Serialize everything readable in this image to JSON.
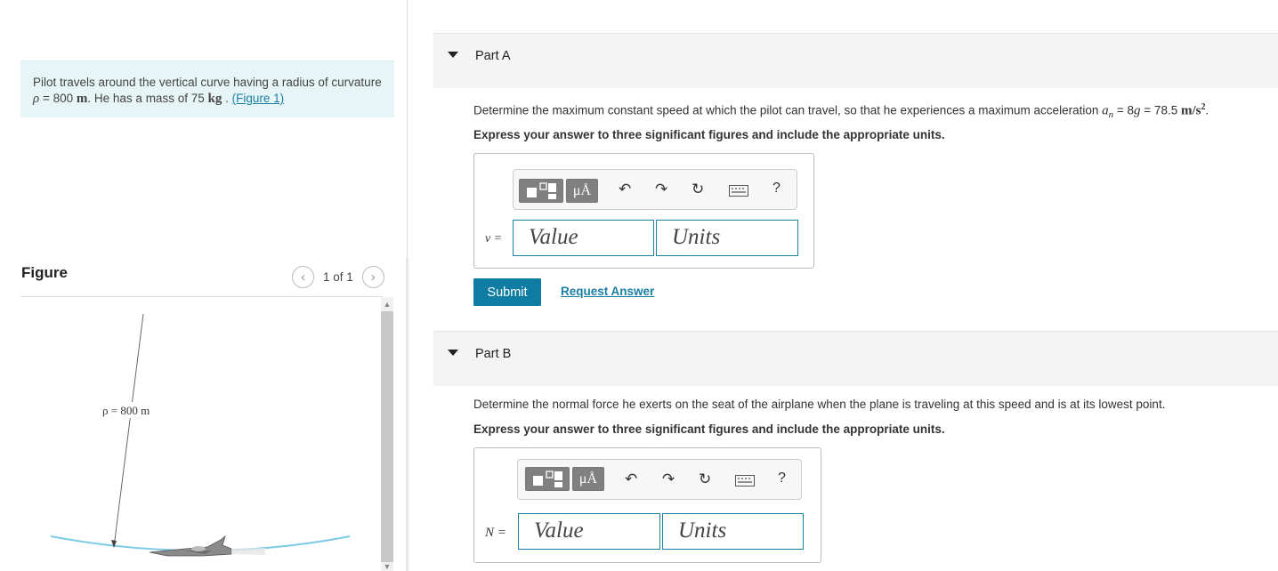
{
  "problem": {
    "text_before_rho": "Pilot travels around the vertical curve having a radius of curvature",
    "rho_symbol": "ρ",
    "rho_value": "= 800",
    "rho_unit": "m",
    "mass_text": ". He has a mass of 75",
    "mass_unit": "kg",
    "figure_link": "(Figure 1)"
  },
  "figure": {
    "title": "Figure",
    "counter": "1 of 1",
    "label": "ρ = 800 m",
    "prev_icon": "chevron-left-icon",
    "next_icon": "chevron-right-icon"
  },
  "partA": {
    "label": "Part A",
    "question": "Determine the maximum constant speed at which the pilot can travel, so that he experiences a maximum acceleration",
    "accel_sym": "a",
    "accel_sub": "n",
    "accel_eq": "= 8",
    "g_sym": "g",
    "accel_val": "= 78.5",
    "accel_unit": "m/s",
    "accel_exp": "2",
    "instruction": "Express your answer to three significant figures and include the appropriate units.",
    "variable": "v =",
    "value_placeholder": "Value",
    "units_placeholder": "Units"
  },
  "partB": {
    "label": "Part B",
    "question": "Determine the normal force he exerts on the seat of the airplane when the plane is traveling at this speed and is at its lowest point.",
    "instruction": "Express your answer to three significant figures and include the appropriate units.",
    "variable": "N =",
    "value_placeholder": "Value",
    "units_placeholder": "Units"
  },
  "toolbar": {
    "units_btn": "μÅ",
    "help": "?"
  },
  "actions": {
    "submit": "Submit",
    "request": "Request Answer"
  },
  "colors": {
    "accent": "#0f7da3",
    "link": "#1a7fa6",
    "problem_bg": "#e8f5f7",
    "curve": "#7fcbe6"
  }
}
